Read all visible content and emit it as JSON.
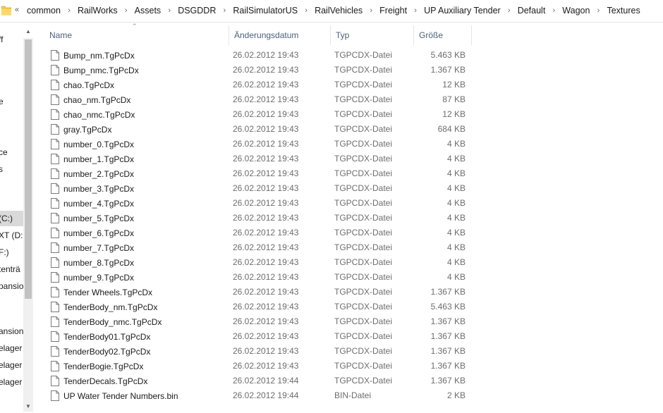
{
  "breadcrumb": {
    "overflow": "«",
    "items": [
      "common",
      "RailWorks",
      "Assets",
      "DSGDDR",
      "RailSimulatorUS",
      "RailVehicles",
      "Freight",
      "UP Auxiliary Tender",
      "Default",
      "Wagon",
      "Textures"
    ],
    "separator": "›"
  },
  "navpane": {
    "items": [
      {
        "text": "ff"
      },
      {
        "text": "e"
      },
      {
        "text": "ce"
      },
      {
        "text": "s"
      },
      {
        "text": "(C:)",
        "selected": true
      },
      {
        "text": "XT (D:"
      },
      {
        "text": "F:)"
      },
      {
        "text": "tenträ"
      },
      {
        "text": "pansio"
      },
      {
        "text": "ansion"
      },
      {
        "text": "elager"
      },
      {
        "text": "elager"
      },
      {
        "text": "elager"
      }
    ]
  },
  "columns": {
    "name": "Name",
    "date": "Änderungsdatum",
    "type": "Typ",
    "size": "Größe"
  },
  "files": [
    {
      "name": "Bump_nm.TgPcDx",
      "date": "26.02.2012 19:43",
      "type": "TGPCDX-Datei",
      "size": "5.463 KB"
    },
    {
      "name": "Bump_nmc.TgPcDx",
      "date": "26.02.2012 19:43",
      "type": "TGPCDX-Datei",
      "size": "1.367 KB"
    },
    {
      "name": "chao.TgPcDx",
      "date": "26.02.2012 19:43",
      "type": "TGPCDX-Datei",
      "size": "12 KB"
    },
    {
      "name": "chao_nm.TgPcDx",
      "date": "26.02.2012 19:43",
      "type": "TGPCDX-Datei",
      "size": "87 KB"
    },
    {
      "name": "chao_nmc.TgPcDx",
      "date": "26.02.2012 19:43",
      "type": "TGPCDX-Datei",
      "size": "12 KB"
    },
    {
      "name": "gray.TgPcDx",
      "date": "26.02.2012 19:43",
      "type": "TGPCDX-Datei",
      "size": "684 KB"
    },
    {
      "name": "number_0.TgPcDx",
      "date": "26.02.2012 19:43",
      "type": "TGPCDX-Datei",
      "size": "4 KB"
    },
    {
      "name": "number_1.TgPcDx",
      "date": "26.02.2012 19:43",
      "type": "TGPCDX-Datei",
      "size": "4 KB"
    },
    {
      "name": "number_2.TgPcDx",
      "date": "26.02.2012 19:43",
      "type": "TGPCDX-Datei",
      "size": "4 KB"
    },
    {
      "name": "number_3.TgPcDx",
      "date": "26.02.2012 19:43",
      "type": "TGPCDX-Datei",
      "size": "4 KB"
    },
    {
      "name": "number_4.TgPcDx",
      "date": "26.02.2012 19:43",
      "type": "TGPCDX-Datei",
      "size": "4 KB"
    },
    {
      "name": "number_5.TgPcDx",
      "date": "26.02.2012 19:43",
      "type": "TGPCDX-Datei",
      "size": "4 KB"
    },
    {
      "name": "number_6.TgPcDx",
      "date": "26.02.2012 19:43",
      "type": "TGPCDX-Datei",
      "size": "4 KB"
    },
    {
      "name": "number_7.TgPcDx",
      "date": "26.02.2012 19:43",
      "type": "TGPCDX-Datei",
      "size": "4 KB"
    },
    {
      "name": "number_8.TgPcDx",
      "date": "26.02.2012 19:43",
      "type": "TGPCDX-Datei",
      "size": "4 KB"
    },
    {
      "name": "number_9.TgPcDx",
      "date": "26.02.2012 19:43",
      "type": "TGPCDX-Datei",
      "size": "4 KB"
    },
    {
      "name": "Tender Wheels.TgPcDx",
      "date": "26.02.2012 19:43",
      "type": "TGPCDX-Datei",
      "size": "1.367 KB"
    },
    {
      "name": "TenderBody_nm.TgPcDx",
      "date": "26.02.2012 19:43",
      "type": "TGPCDX-Datei",
      "size": "5.463 KB"
    },
    {
      "name": "TenderBody_nmc.TgPcDx",
      "date": "26.02.2012 19:43",
      "type": "TGPCDX-Datei",
      "size": "1.367 KB"
    },
    {
      "name": "TenderBody01.TgPcDx",
      "date": "26.02.2012 19:43",
      "type": "TGPCDX-Datei",
      "size": "1.367 KB"
    },
    {
      "name": "TenderBody02.TgPcDx",
      "date": "26.02.2012 19:43",
      "type": "TGPCDX-Datei",
      "size": "1.367 KB"
    },
    {
      "name": "TenderBogie.TgPcDx",
      "date": "26.02.2012 19:43",
      "type": "TGPCDX-Datei",
      "size": "1.367 KB"
    },
    {
      "name": "TenderDecals.TgPcDx",
      "date": "26.02.2012 19:44",
      "type": "TGPCDX-Datei",
      "size": "1.367 KB"
    },
    {
      "name": "UP Water Tender Numbers.bin",
      "date": "26.02.2012 19:44",
      "type": "BIN-Datei",
      "size": "2 KB"
    }
  ],
  "colors": {
    "header_text": "#4c607a",
    "meta_text": "#6d6d6d",
    "folder": "#f3c94d",
    "selected_nav": "#d9d9d9"
  },
  "icons": {
    "address_folder": "folder-icon",
    "overflow": "chevrons-left-icon",
    "file": "file-icon",
    "sort": "sort-up-icon"
  }
}
